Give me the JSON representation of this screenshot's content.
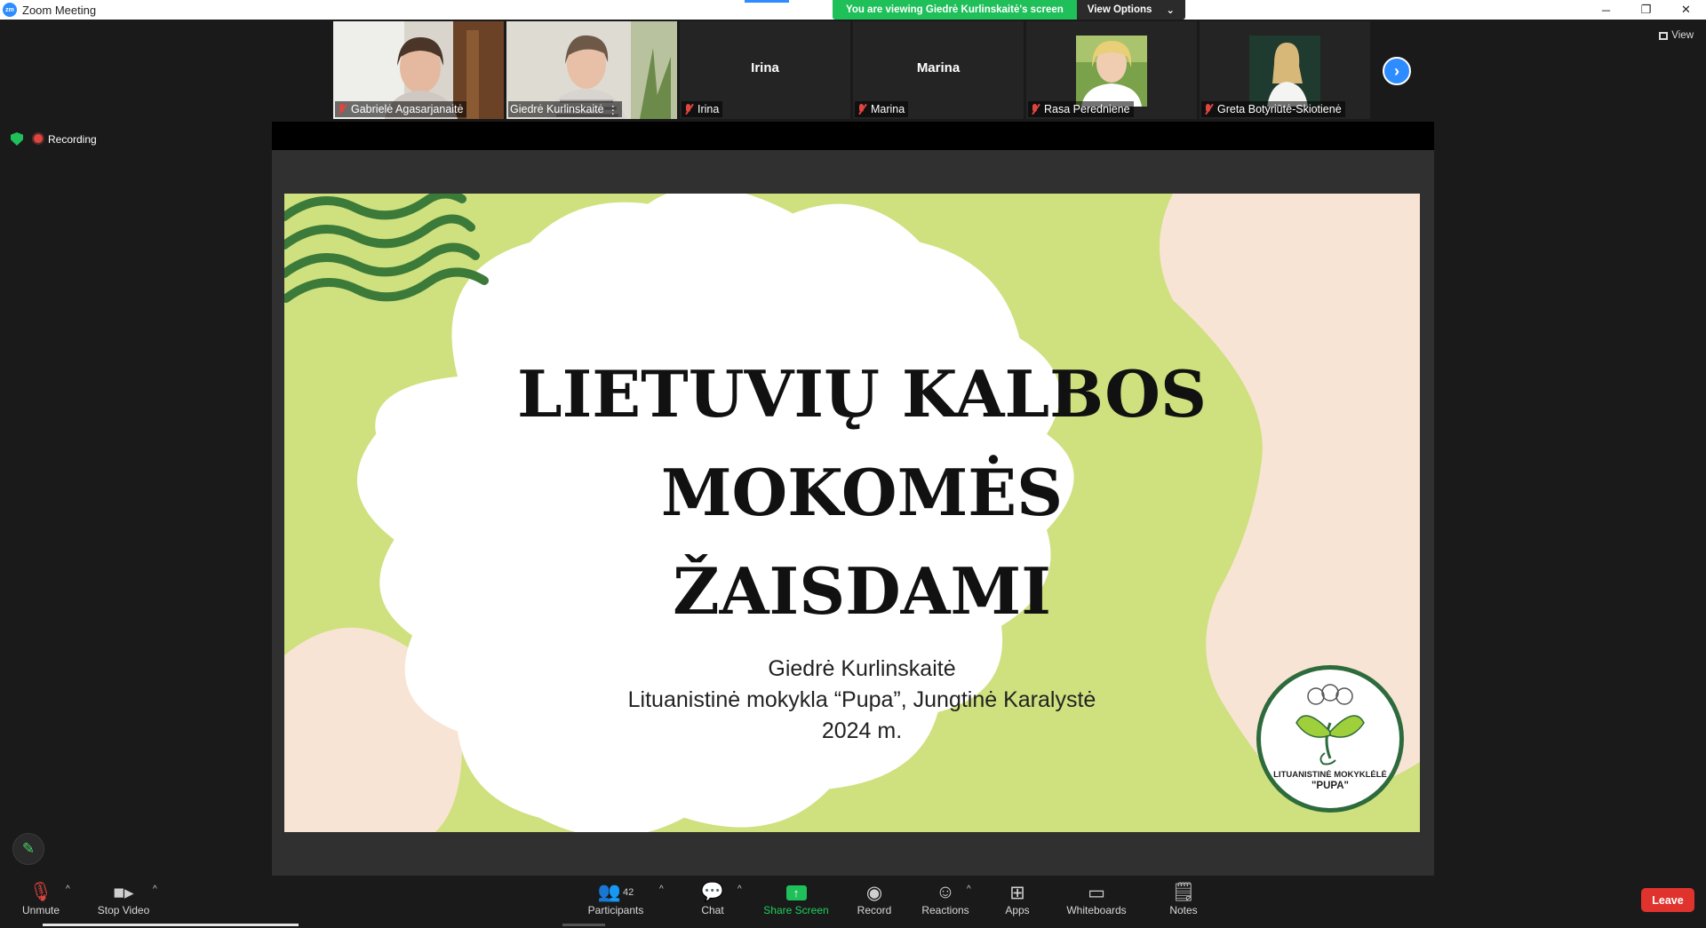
{
  "window": {
    "title": "Zoom Meeting",
    "controls": [
      "─",
      "❐",
      "✕"
    ]
  },
  "banner": {
    "viewing_text": "You are viewing Giedrė Kurlinskaitė's screen",
    "view_options": "View Options"
  },
  "participants_strip": [
    {
      "name": "Gabrielė Agasarjanaitė",
      "has_video": true,
      "muted": true
    },
    {
      "name": "Giedrė Kurlinskaitė",
      "has_video": true,
      "muted": false,
      "active": true
    },
    {
      "name": "Irina",
      "has_video": false,
      "muted": true
    },
    {
      "name": "Marina",
      "has_video": false,
      "muted": true
    },
    {
      "name": "Rasa Peredniene",
      "has_video": true,
      "muted": true
    },
    {
      "name": "Greta Botyriūtė-Skiotienė",
      "has_video": true,
      "muted": true
    }
  ],
  "view_button": "View",
  "status": {
    "recording": "Recording"
  },
  "slide": {
    "title_lines": [
      "LIETUVIŲ KALBOS",
      "MOKOMĖS",
      "ŽAISDAMI"
    ],
    "subtitle_lines": [
      "Giedrė Kurlinskaitė",
      "Lituanistinė mokykla “Pupa”, Jungtinė Karalystė",
      "2024 m."
    ],
    "logo_line1": "LITUANISTINĖ MOKYKLĖLĖ",
    "logo_line2": "\"PUPA\""
  },
  "toolbar": {
    "unmute": "Unmute",
    "stop_video": "Stop Video",
    "participants": "Participants",
    "participants_count": "42",
    "chat": "Chat",
    "share_screen": "Share Screen",
    "record": "Record",
    "reactions": "Reactions",
    "apps": "Apps",
    "whiteboards": "Whiteboards",
    "notes": "Notes",
    "leave": "Leave"
  },
  "colors": {
    "zoom_blue": "#2d8cff",
    "green": "#1fbf5a",
    "leave_red": "#e0332e",
    "slide_green": "#cfe07e",
    "slide_peach": "#f8e4d4"
  }
}
